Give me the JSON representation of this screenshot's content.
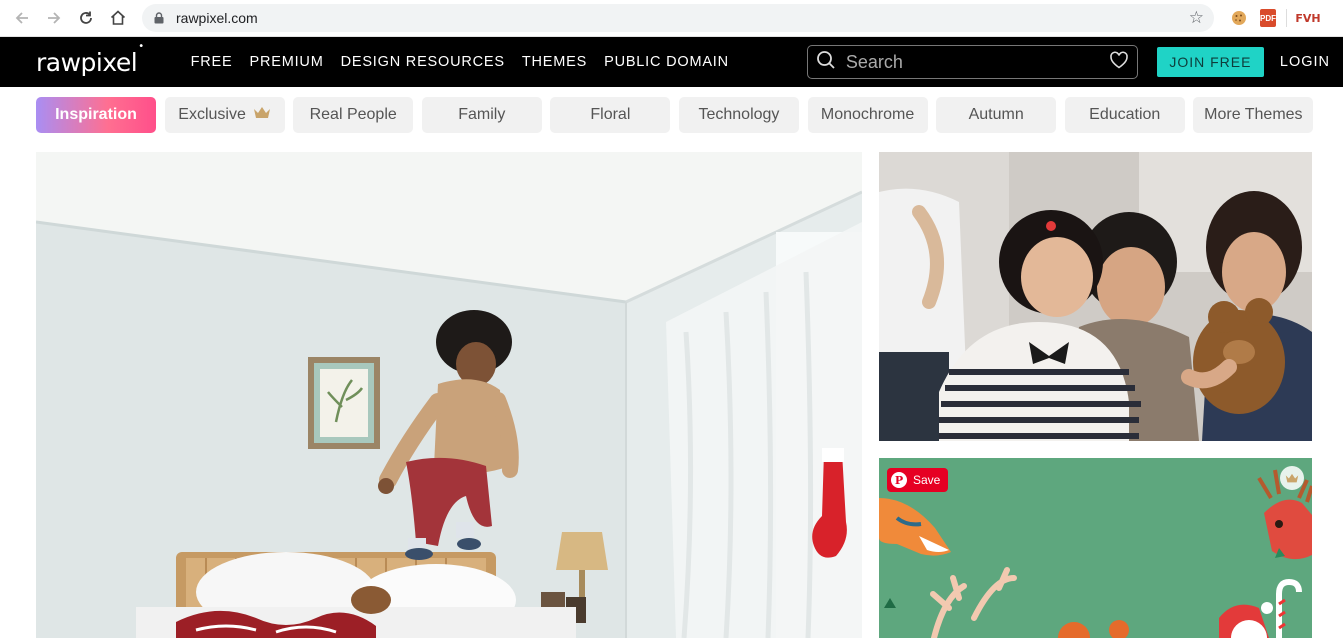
{
  "browser": {
    "url": "rawpixel.com",
    "extensions": {
      "pdf_label": "PDF",
      "fvh_label": "FVH"
    }
  },
  "header": {
    "logo": "rawpixel",
    "logo_mark": "•",
    "nav": [
      "FREE",
      "PREMIUM",
      "DESIGN RESOURCES",
      "THEMES",
      "PUBLIC DOMAIN"
    ],
    "search_placeholder": "Search",
    "join_label": "JOIN FREE",
    "login_label": "LOGIN"
  },
  "chips": [
    {
      "label": "Inspiration",
      "active": true
    },
    {
      "label": "Exclusive",
      "crown": true
    },
    {
      "label": "Real People"
    },
    {
      "label": "Family"
    },
    {
      "label": "Floral"
    },
    {
      "label": "Technology"
    },
    {
      "label": "Monochrome"
    },
    {
      "label": "Autumn"
    },
    {
      "label": "Education"
    },
    {
      "label": "More Themes"
    }
  ],
  "photos": {
    "save_label": "Save"
  },
  "colors": {
    "accent": "#1fd3c6",
    "header_bg": "#000000",
    "pinterest_red": "#e60023",
    "chip_gradient_start": "#a98ef3",
    "chip_gradient_end": "#ff4f8a",
    "premium_crown": "#c9a46a"
  },
  "icons": {
    "back": "back-arrow-icon",
    "forward": "forward-arrow-icon",
    "reload": "reload-icon",
    "home": "home-icon",
    "lock": "lock-icon",
    "star": "bookmark-star-icon",
    "search": "search-icon",
    "heart": "heart-icon",
    "crown": "crown-icon"
  }
}
